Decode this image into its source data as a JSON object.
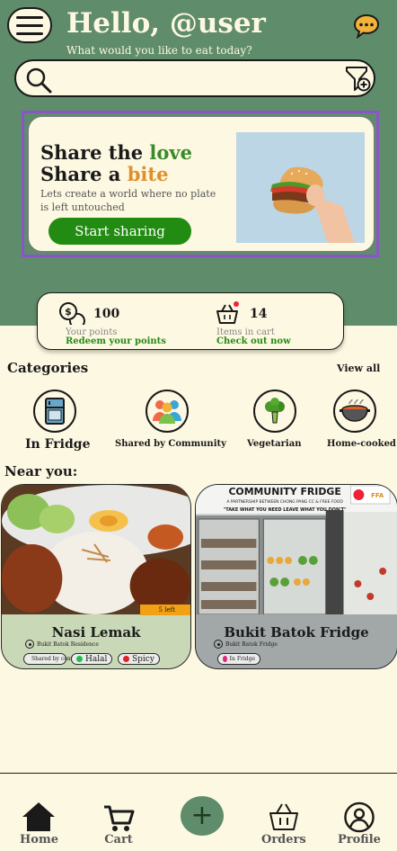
{
  "header": {
    "menu_icon": "hamburger-icon",
    "greeting": "Hello, @user",
    "subtitle": "What would you like to eat today?",
    "chat_icon": "chat-icon"
  },
  "search": {
    "placeholder": "",
    "search_icon": "search-icon",
    "filter_icon": "filter-icon"
  },
  "promo": {
    "line1_prefix": "Share the ",
    "line1_highlight": "love",
    "line2_prefix": "Share a ",
    "line2_highlight": "bite",
    "description": "Lets create a world where no plate is left untouched",
    "button_label": "Start sharing"
  },
  "stats": {
    "points_value": "100",
    "points_label": "Your points",
    "points_link": "Redeem your points",
    "cart_value": "14",
    "cart_label": "Items in cart",
    "cart_link": "Check out now"
  },
  "categories": {
    "title": "Categories",
    "view_all": "View all",
    "items": [
      {
        "label": "In Fridge",
        "icon": "fridge-icon"
      },
      {
        "label": "Shared by Community",
        "icon": "community-icon"
      },
      {
        "label": "Vegetarian",
        "icon": "broccoli-icon"
      },
      {
        "label": "Home-cooked",
        "icon": "pot-icon"
      }
    ]
  },
  "near": {
    "title": "Near you:",
    "cards": [
      {
        "name": "Nasi Lemak",
        "badge": "5 left",
        "location": "Bukit Batok Residence",
        "tags": [
          {
            "label": "Shared by community",
            "color": "#e0287a"
          },
          {
            "label": "Halal",
            "color": "#1fbf4a"
          },
          {
            "label": "Spicy",
            "color": "#e22121"
          }
        ]
      },
      {
        "name": "Bukit Batok Fridge",
        "location": "Bukit Batok Fridge",
        "sign_text": "COMMUNITY FRIDGE",
        "sign_sub": "A PARTNERSHIP BETWEEN CHONG PANG CC & FREE FOOD",
        "sign_tag": "\"TAKE WHAT YOU NEED LEAVE WHAT YOU DON'T\"",
        "logo_text": "FFA",
        "tags": [
          {
            "label": "In Fridge",
            "color": "#e0287a"
          }
        ]
      }
    ]
  },
  "nav": {
    "home": "Home",
    "cart": "Cart",
    "add": "+",
    "orders": "Orders",
    "profile": "Profile"
  },
  "colors": {
    "header_green": "#5f8c6a",
    "cream": "#fdf8e2",
    "cta_green": "#228b12",
    "accent_orange": "#e0902a",
    "selection_purple": "#8a55c9"
  }
}
